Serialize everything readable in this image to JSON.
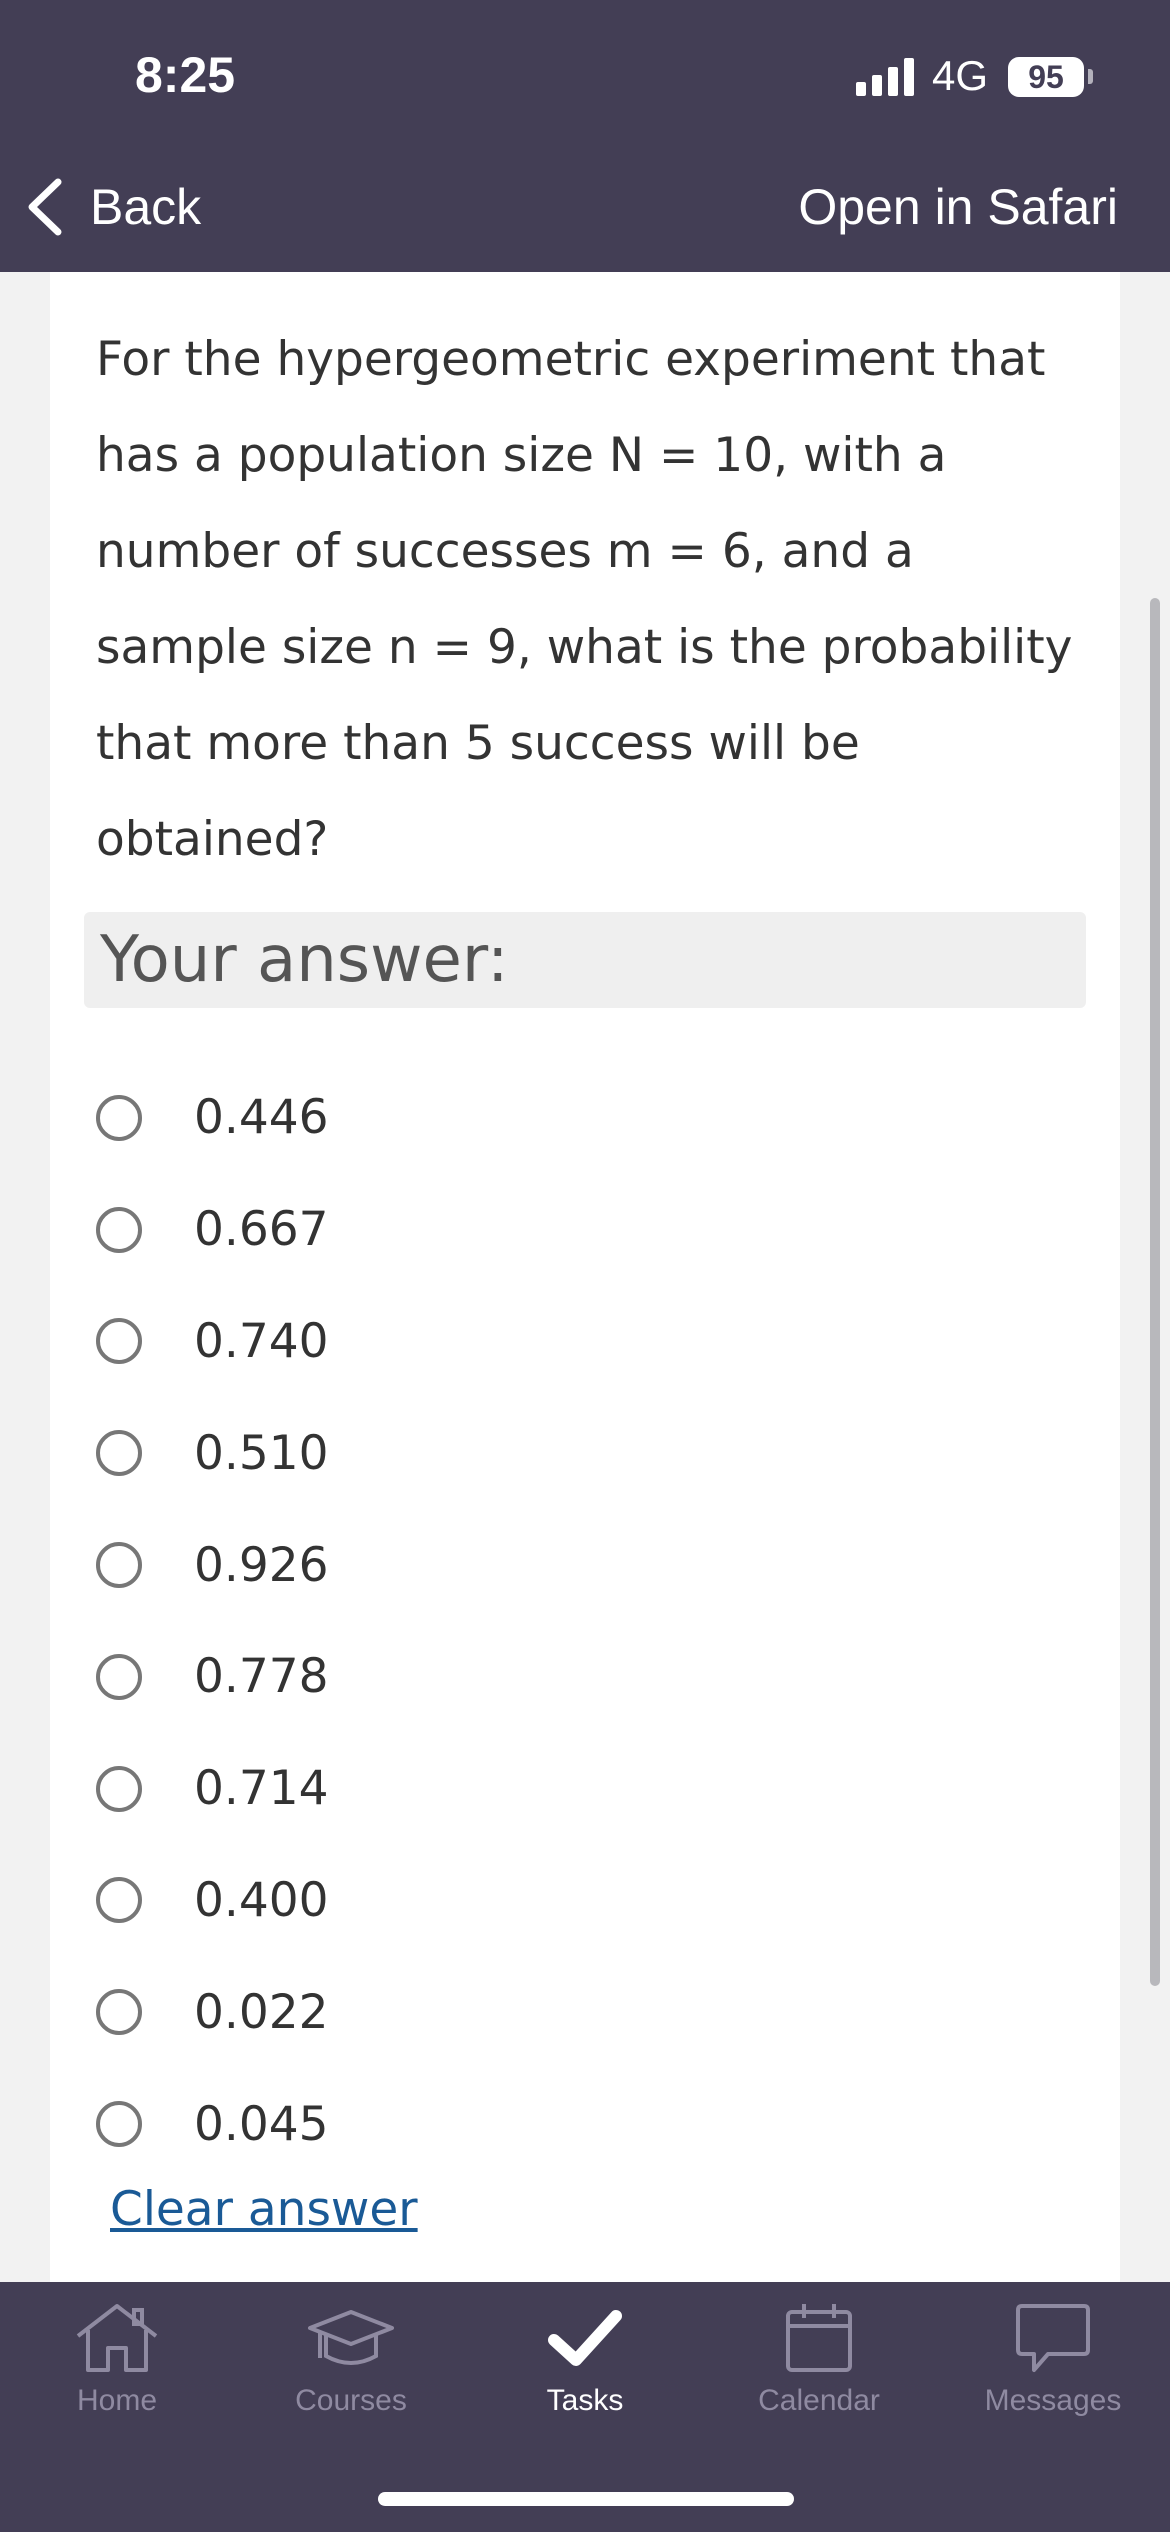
{
  "status_bar": {
    "time": "8:25",
    "network": "4G",
    "battery": "95"
  },
  "nav": {
    "back_label": "Back",
    "open_safari_label": "Open in Safari"
  },
  "question": {
    "text": "For the hypergeometric experiment that has a population size N = 10, with a number of successes m = 6, and a sample size n = 9, what is the probability that more than 5 success will be obtained?"
  },
  "answer": {
    "label": "Your answer:",
    "options": [
      "0.446",
      "0.667",
      "0.740",
      "0.510",
      "0.926",
      "0.778",
      "0.714",
      "0.400",
      "0.022",
      "0.045"
    ],
    "selected": null,
    "clear_label": "Clear answer"
  },
  "tabbar": {
    "items": [
      {
        "label": "Home",
        "icon": "home-icon",
        "active": false
      },
      {
        "label": "Courses",
        "icon": "graduation-cap-icon",
        "active": false
      },
      {
        "label": "Tasks",
        "icon": "checkmark-icon",
        "active": true
      },
      {
        "label": "Calendar",
        "icon": "calendar-icon",
        "active": false
      },
      {
        "label": "Messages",
        "icon": "chat-bubble-icon",
        "active": false
      }
    ]
  },
  "colors": {
    "header_bg": "#433e55",
    "link": "#1a5a96",
    "tab_inactive": "#8f8aa1"
  }
}
